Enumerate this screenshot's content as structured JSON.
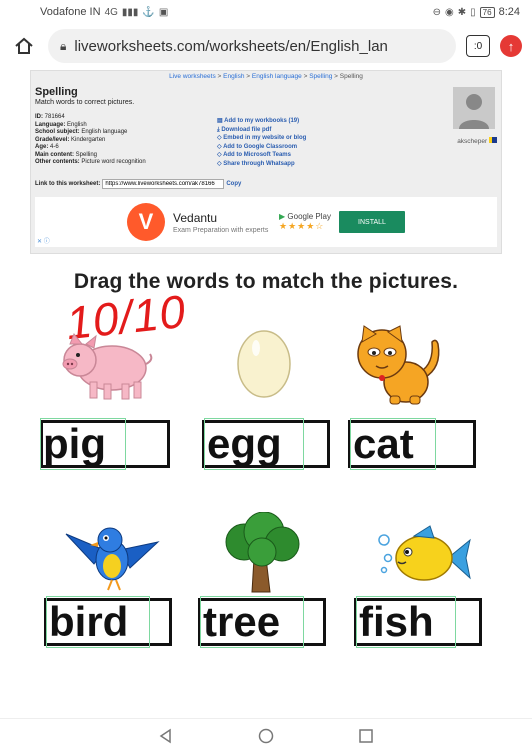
{
  "status": {
    "carrier": "Vodafone IN",
    "network": "4G",
    "battery": "76",
    "time": "8:24"
  },
  "browser": {
    "url": "liveworksheets.com/worksheets/en/English_lan",
    "tabs_label": ":0"
  },
  "breadcrumb": [
    "Live worksheets",
    "English",
    "English language",
    "Spelling",
    "Spelling"
  ],
  "worksheet": {
    "title": "Spelling",
    "subtitle": "Match words to correct pictures.",
    "meta": [
      {
        "label": "ID:",
        "value": "781664"
      },
      {
        "label": "Language:",
        "value": "English"
      },
      {
        "label": "School subject:",
        "value": "English language"
      },
      {
        "label": "Grade/level:",
        "value": "Kindergarten"
      },
      {
        "label": "Age:",
        "value": "4-6"
      },
      {
        "label": "Main content:",
        "value": "Spelling"
      },
      {
        "label": "Other contents:",
        "value": "Picture word recognition"
      }
    ],
    "actions": [
      "Add to my workbooks (19)",
      "Download file pdf",
      "Embed in my website or blog",
      "Add to Google Classroom",
      "Add to Microsoft Teams",
      "Share through Whatsapp"
    ],
    "author": "akscheper",
    "link_label": "Link to this worksheet:",
    "link_value": "https://www.liveworksheets.com/ak78166",
    "copy_label": "Copy"
  },
  "ad": {
    "brand": "Vedantu",
    "tagline": "Exam Preparation with experts",
    "store": "Google Play",
    "stars": "★★★★☆",
    "install": "INSTALL"
  },
  "exercise": {
    "instructions": "Drag the words to match the pictures.",
    "score": "10/10",
    "items": [
      {
        "word": "pig",
        "picture": "pig-icon"
      },
      {
        "word": "egg",
        "picture": "egg-icon"
      },
      {
        "word": "cat",
        "picture": "cat-icon"
      },
      {
        "word": "bird",
        "picture": "bird-icon"
      },
      {
        "word": "tree",
        "picture": "tree-icon"
      },
      {
        "word": "fish",
        "picture": "fish-icon"
      }
    ]
  },
  "colors": {
    "score": "#e31b1b",
    "link": "#2a6fd6",
    "install": "#1a8b5f",
    "drop_border": "#7ed8a0"
  }
}
